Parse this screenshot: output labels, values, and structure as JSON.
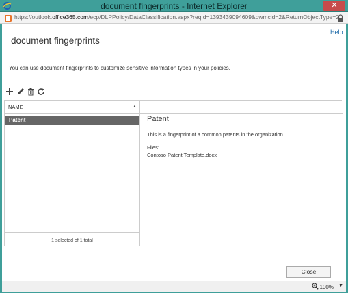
{
  "window": {
    "title": "document fingerprints - Internet Explorer",
    "close_glyph": "✕"
  },
  "address": {
    "scheme": "https://outlook.",
    "host": "office365.com",
    "path": "/ecp/DLPPolicy/DataClassification.aspx?reqId=1393439094609&pwmcid=2&ReturnObjectType=2"
  },
  "help_label": "Help",
  "page_title": "document fingerprints",
  "intro_text": "You can use document fingerprints to customize sensitive information types in your policies.",
  "toolbar": {
    "buttons": [
      {
        "name": "add-icon",
        "label": "new"
      },
      {
        "name": "edit-icon",
        "label": "edit"
      },
      {
        "name": "delete-icon",
        "label": "delete"
      },
      {
        "name": "refresh-icon",
        "label": "refresh"
      }
    ]
  },
  "list": {
    "column_header": "NAME",
    "sort_glyph": "▲",
    "rows": [
      {
        "name": "Patent",
        "selected": true
      }
    ],
    "footer": "1 selected of 1 total"
  },
  "detail": {
    "title": "Patent",
    "description": "This is a fingerprint of a common patents in the organization",
    "files_label": "Files:",
    "files": [
      "Contoso Patent Template.docx"
    ]
  },
  "close_button_label": "Close",
  "status": {
    "zoom": "100%",
    "zoom_dropdown_glyph": "▼"
  },
  "colors": {
    "titlebar": "#3f9f9a",
    "selected_row": "#666666",
    "link": "#1e6aa8",
    "close_red": "#c74b4b"
  }
}
